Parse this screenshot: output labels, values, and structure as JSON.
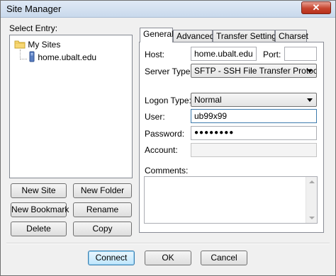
{
  "window": {
    "title": "Site Manager",
    "close_glyph": "✕"
  },
  "tree": {
    "label": "Select Entry:",
    "root_label": "My Sites",
    "root_icon": "folder-icon",
    "child_label": "home.ubalt.edu",
    "child_icon": "server-icon"
  },
  "left_buttons": {
    "new_site": "New Site",
    "new_folder": "New Folder",
    "new_bookmark": "New Bookmark",
    "rename": "Rename",
    "delete": "Delete",
    "copy": "Copy"
  },
  "tabs": [
    {
      "label": "General",
      "active": true
    },
    {
      "label": "Advanced",
      "active": false
    },
    {
      "label": "Transfer Settings",
      "active": false
    },
    {
      "label": "Charset",
      "active": false
    }
  ],
  "general": {
    "host_label": "Host:",
    "host_value": "home.ubalt.edu",
    "port_label": "Port:",
    "port_value": "",
    "server_type_label": "Server Type:",
    "server_type_value": "SFTP - SSH File Transfer Protocol",
    "logon_type_label": "Logon Type:",
    "logon_type_value": "Normal",
    "user_label": "User:",
    "user_value": "ub99x99",
    "password_label": "Password:",
    "password_value": "●●●●●●●●",
    "account_label": "Account:",
    "account_value": "",
    "comments_label": "Comments:",
    "comments_value": ""
  },
  "bottom_buttons": {
    "connect": "Connect",
    "ok": "OK",
    "cancel": "Cancel"
  }
}
